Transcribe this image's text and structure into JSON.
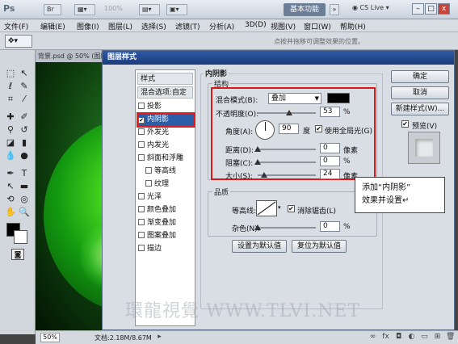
{
  "app": {
    "logo": "Ps",
    "zoom_level": "100%",
    "workspace_button": "基本功能",
    "cs_live": "CS Live",
    "win_min": "–",
    "win_max": "□",
    "win_close": "x"
  },
  "menu": [
    "文件(F)",
    "编辑(E)",
    "图像(I)",
    "图层(L)",
    "选择(S)",
    "滤镜(T)",
    "分析(A)",
    "3D(D)",
    "视图(V)",
    "窗口(W)",
    "帮助(H)"
  ],
  "options_bar": {
    "hint": "点按并拖移可调整效果的位置。"
  },
  "document": {
    "tab": "背景.psd @ 50% (图层 1,",
    "zoom": "50%",
    "doc_size": "文档:2.18M/8.67M"
  },
  "dialog": {
    "title": "图层样式",
    "style_list": {
      "header": "样式",
      "blend_options": "混合选项:自定",
      "items": [
        "投影",
        "内阴影",
        "外发光",
        "内发光",
        "斜面和浮雕",
        "等高线",
        "纹理",
        "光泽",
        "颜色叠加",
        "渐变叠加",
        "图案叠加",
        "描边"
      ],
      "checked": [
        false,
        true,
        false,
        false,
        false,
        false,
        false,
        false,
        false,
        false,
        false,
        false
      ]
    },
    "section_title": "内阴影",
    "structure": {
      "label": "结构",
      "blend_mode_label": "混合模式(B):",
      "blend_mode_value": "叠加",
      "shadow_color": "#000000",
      "opacity_label": "不透明度(O):",
      "opacity_value": "53",
      "opacity_unit": "%",
      "angle_label": "角度(A):",
      "angle_value": "90",
      "angle_unit": "度",
      "global_light_label": "使用全局光(G)",
      "global_light_checked": true,
      "distance_label": "距离(D):",
      "distance_value": "0",
      "distance_unit": "像素",
      "choke_label": "阻塞(C):",
      "choke_value": "0",
      "choke_unit": "%",
      "size_label": "大小(S):",
      "size_value": "24",
      "size_unit": "像素"
    },
    "quality": {
      "label": "品质",
      "contour_label": "等高线:",
      "antialias_label": "消除锯齿(L)",
      "antialias_checked": true,
      "noise_label": "杂色(N):",
      "noise_value": "0",
      "noise_unit": "%"
    },
    "buttons": {
      "make_default": "设置为默认值",
      "reset_default": "复位为默认值",
      "ok": "确定",
      "cancel": "取消",
      "new_style": "新建样式(W)...",
      "preview": "预览(V)"
    },
    "preview_checked": true
  },
  "callout": {
    "line1": "添加“内阴影”",
    "line2": "效果并设置↵"
  },
  "watermark": "環龍視覺 WWW.TLVI.NET"
}
